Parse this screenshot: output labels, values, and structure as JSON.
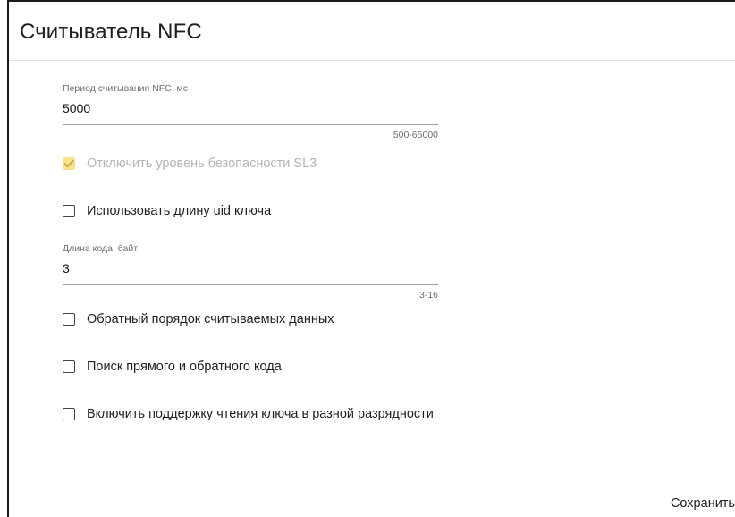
{
  "panel": {
    "title": "Считыватель NFC"
  },
  "fields": {
    "read_period": {
      "label": "Период считывания NFC, мс",
      "value": "5000",
      "hint": "500-65000"
    },
    "code_length": {
      "label": "Длина кода, байт",
      "value": "3",
      "hint": "3-16"
    }
  },
  "checkboxes": {
    "disable_sl3": {
      "label": "Отключить уровень безопасности SL3",
      "checked": true,
      "disabled": true
    },
    "use_uid_length": {
      "label": "Использовать длину uid ключа",
      "checked": false
    },
    "reverse_order": {
      "label": "Обратный порядок считываемых данных",
      "checked": false
    },
    "search_forward_reverse": {
      "label": "Поиск прямого и обратного кода",
      "checked": false
    },
    "variable_bit_depth": {
      "label": "Включить поддержку чтения ключа в разной разрядности",
      "checked": false
    }
  },
  "actions": {
    "save_label": "Сохранить"
  },
  "colors": {
    "checked_disabled_fill": "#fbe18c",
    "checkmark": "#c7a43a",
    "disabled_text": "#b5b5b5",
    "underline": "#9e9e9e"
  },
  "icons": {
    "checkmark": "check-icon"
  }
}
